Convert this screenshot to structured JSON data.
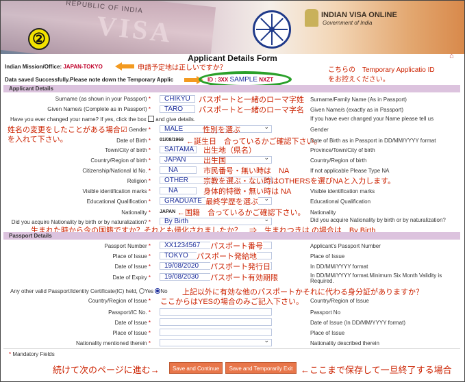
{
  "header": {
    "step_number": "②",
    "visa_text": "VISA",
    "republic_text": "REPUBLIC OF INDIA",
    "brand": "INDIAN VISA ONLINE",
    "brand_sub": "Government of India",
    "form_title": "Applicant Details Form"
  },
  "mission": {
    "label": "Indian Mission/Office:",
    "value": "JAPAN-TOKYO",
    "anno": "申請予定地は正しいですか？"
  },
  "saved": {
    "text": "Data saved Successfully.Please note down the Temporary Applic",
    "id_label": "ID : 3XX",
    "id_value": "SAMPLE",
    "id_tail": "NXZT",
    "anno_line1": "こちらの　Temporary Applicatio ID",
    "anno_line2": "をお控えください。"
  },
  "sections": {
    "applicant": "Applicant Details",
    "passport": "Passport Details"
  },
  "applicant": {
    "surname": {
      "label": "Surname (as shown in your Passport)",
      "value": "CHIKYU",
      "anno": "パスポートと一緒のローマ字姓",
      "hint": "Surname/Family Name (As in Passport)"
    },
    "given": {
      "label": "Given Name/s (Complete as in Passport)",
      "value": "TARO",
      "anno": "パスポートと一緒のローマ字名",
      "hint": "Given Name/s (exactly as in Passport)"
    },
    "changed": {
      "label": "Have you ever changed your name? If yes, click the box",
      "tail": "and give details.",
      "hint": "If you have ever changed your Name please tell us"
    },
    "name_change_anno1": "姓名の変更をしたことがある場合☑︎",
    "name_change_anno2": "を入れて下さい。",
    "gender": {
      "label": "Gender",
      "value": "MALE",
      "anno": "性別を選ぶ",
      "hint": "Gender"
    },
    "dob": {
      "label": "Date of Birth",
      "value": "01/08/1969",
      "anno": "←誕生日　合っているかご確認下さい。",
      "hint": "Date of Birth as in Passport in DD/MM/YYYY format"
    },
    "town": {
      "label": "Town/City of birth",
      "value": "SAITAMA",
      "anno": "出生地（県名）",
      "hint": "Province/Town/City of birth"
    },
    "country": {
      "label": "Country/Region of birth",
      "value": "JAPAN",
      "anno": "出生国",
      "hint": "Country/Region of birth"
    },
    "citizen": {
      "label": "Citizenship/National Id No.",
      "value": "NA",
      "anno": "市民番号・無い時は　NA",
      "hint": "If not applicable Please Type NA"
    },
    "religion": {
      "label": "Religion",
      "value": "OTHER",
      "anno": "宗教を選ぶ・ない時はOTHERSを選びNAと入力します。"
    },
    "marks": {
      "label": "Visible identification marks",
      "value": "NA",
      "anno": "身体的特徴・無い時は NA",
      "hint": "Visible identification marks"
    },
    "education": {
      "label": "Educational Qualification",
      "value": "GRADUATE",
      "anno": "最終学歴を選ぶ",
      "hint": "Educational Qualification"
    },
    "nationality": {
      "label": "Nationality",
      "value": "JAPAN",
      "anno": "←国籍　合っているかご確認下さい。",
      "hint": "Nationality"
    },
    "acquire": {
      "label": "Did you acquire Nationality by birth or by naturalization?",
      "value": "By Birth",
      "hint": "Did you acquire Nationality by birth or by naturalization?"
    },
    "acquire_anno": "生まれた時から今の国籍ですか？それとも帰化されましたか？　⇒　生まれつきは の場合は　By Birth"
  },
  "passport": {
    "number": {
      "label": "Passport Number",
      "value": "XX1234567",
      "anno": "パスポート番号",
      "hint": "Applicant's Passport Number"
    },
    "place": {
      "label": "Place of Issue",
      "value": "TOKYO",
      "anno": "パスポート発給地",
      "hint": "Place of Issue"
    },
    "issue": {
      "label": "Date of Issue",
      "value": "19/08/2020",
      "anno": "パスポート発行日",
      "hint": "In DD/MM/YYYY format"
    },
    "expiry": {
      "label": "Date of Expiry",
      "value": "19/08/2030",
      "anno": "パスポート有効期限",
      "hint": "In DD/MM/YYYY format.Minimum Six Month Validity is Required."
    },
    "other": {
      "label": "Any other valid Passport/Identity Certificate(IC) held,",
      "yes": "Yes",
      "no": "No",
      "anno": "上記以外に有効な他のパスポートかそれに代わる身分証がありますか？"
    },
    "other_country": {
      "label": "Country/Region of Issue",
      "anno": "ここからはYESの場合のみご記入下さい。",
      "hint": "Country/Region of Issue"
    },
    "ic_no": {
      "label": "Passport/IC No.",
      "hint": "Passport No"
    },
    "ic_issue": {
      "label": "Date of Issue",
      "hint": "Date of Issue (In DD/MM/YYYY format)"
    },
    "ic_place": {
      "label": "Place of Issue",
      "hint": "Place of Issue"
    },
    "ic_nat": {
      "label": "Nationality mentioned therein",
      "hint": "Nationality described therein"
    }
  },
  "footer": {
    "mandatory": "Mandatory Fields",
    "anno_left": "続けて次のページに進む→",
    "save_continue": "Save and Continue",
    "save_exit": "Save and Temporarily Exit",
    "anno_right": "←ここまで保存して一旦終了する場合"
  },
  "colors": {
    "annotation": "#cc2200",
    "field_value": "#1a2c9a",
    "section": "#dcc3de",
    "button": "#e8764a",
    "oval": "#2aa02a"
  }
}
